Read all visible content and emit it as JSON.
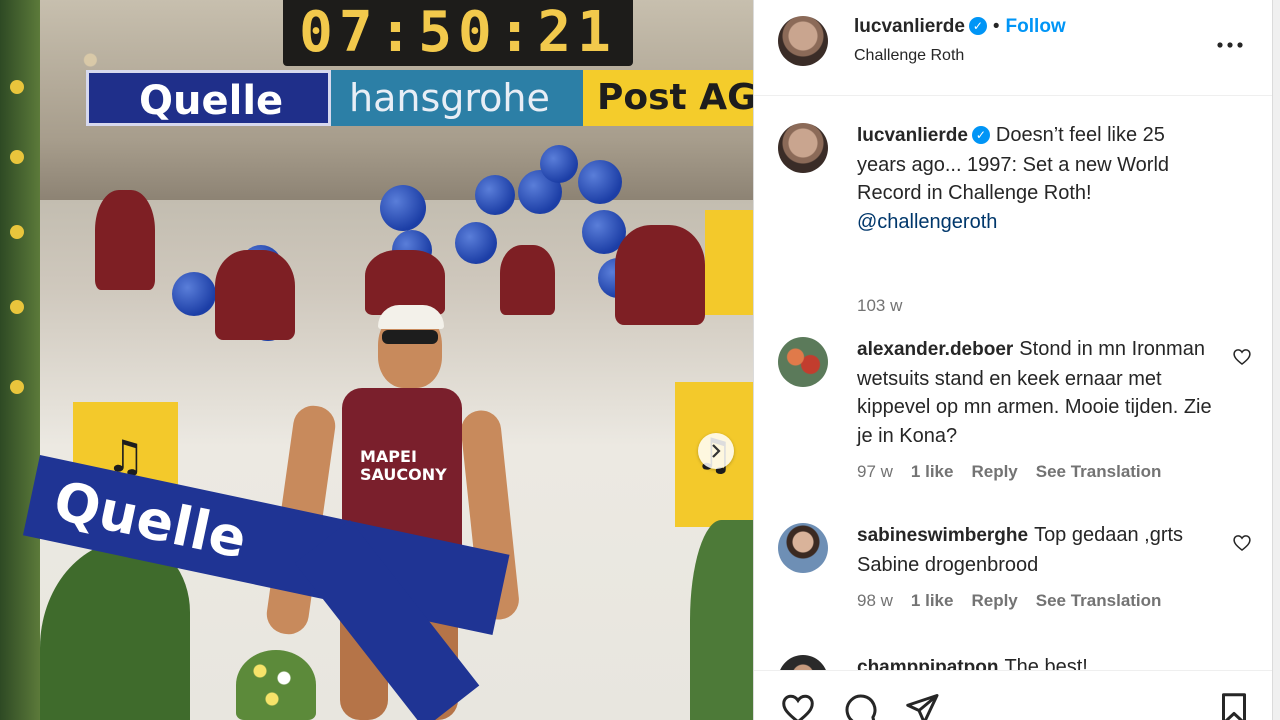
{
  "photo": {
    "clock_text": "07:50:21",
    "banners": [
      "Quelle",
      "hansgrohe",
      "Post AG"
    ],
    "tape_text": "Quelle",
    "bib_text": "MAPEI SAUCONY",
    "next_icon": "chevron-right-icon"
  },
  "header": {
    "username": "lucvanlierde",
    "separator": "•",
    "follow_label": "Follow",
    "location": "Challenge Roth",
    "more_icon": "more-horizontal-icon"
  },
  "caption": {
    "username": "lucvanlierde",
    "text": "Doesn’t feel like 25 years ago... 1997: Set a new World Record in Challenge Roth!",
    "mention": "@challengeroth",
    "age": "103 w"
  },
  "comments": [
    {
      "username": "alexander.deboer",
      "text": "Stond in mn Ironman wetsuits stand en keek ernaar met kippevel op mn armen. Mooie tijden. Zie je in Kona?",
      "age": "97 w",
      "likes": "1 like",
      "reply": "Reply",
      "translate": "See Translation"
    },
    {
      "username": "sabineswimberghe",
      "text": "Top gedaan ,grts Sabine drogenbrood",
      "age": "98 w",
      "likes": "1 like",
      "reply": "Reply",
      "translate": "See Translation"
    },
    {
      "username": "champpipatpon",
      "text": "The best!"
    }
  ],
  "actions": {
    "like_icon": "heart-icon",
    "comment_icon": "comment-icon",
    "share_icon": "send-icon",
    "save_icon": "bookmark-icon"
  },
  "colors": {
    "accent": "#0095f6",
    "text": "#262626",
    "muted": "#737373",
    "link": "#00376b"
  }
}
